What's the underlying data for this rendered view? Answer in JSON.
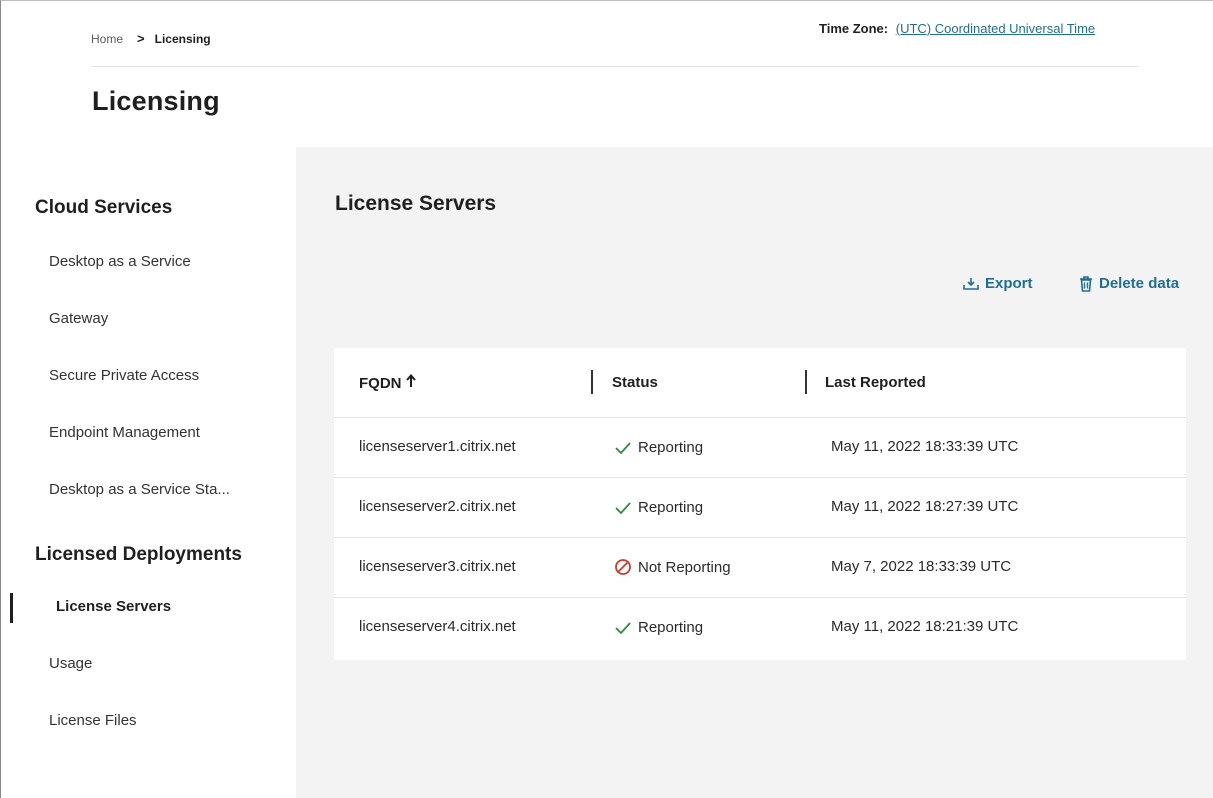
{
  "breadcrumb": {
    "home": "Home",
    "separator": ">",
    "current": "Licensing"
  },
  "timezone": {
    "label": "Time Zone:",
    "value": "(UTC) Coordinated Universal Time"
  },
  "page_title": "Licensing",
  "sidebar": {
    "cloud_heading": "Cloud Services",
    "cloud_items": [
      {
        "label": "Desktop as a Service"
      },
      {
        "label": "Gateway"
      },
      {
        "label": "Secure Private Access"
      },
      {
        "label": "Endpoint Management"
      },
      {
        "label": "Desktop as a Service Sta..."
      }
    ],
    "deploy_heading": "Licensed Deployments",
    "deploy_items": [
      {
        "label": "License Servers",
        "active": true
      },
      {
        "label": "Usage"
      },
      {
        "label": "License Files"
      }
    ]
  },
  "main": {
    "title": "License Servers",
    "actions": {
      "export": "Export",
      "delete": "Delete data"
    },
    "table": {
      "headers": {
        "fqdn": "FQDN",
        "status": "Status",
        "last_reported": "Last Reported"
      },
      "sort_icon": "arrow-up-icon",
      "rows": [
        {
          "fqdn": "licenseserver1.citrix.net",
          "status": "Reporting",
          "status_icon": "check-icon",
          "last_reported": "May 11, 2022 18:33:39 UTC"
        },
        {
          "fqdn": "licenseserver2.citrix.net",
          "status": "Reporting",
          "status_icon": "check-icon",
          "last_reported": "May 11, 2022 18:27:39 UTC"
        },
        {
          "fqdn": "licenseserver3.citrix.net",
          "status": "Not Reporting",
          "status_icon": "prohibited-icon",
          "last_reported": "May 7, 2022 18:33:39 UTC"
        },
        {
          "fqdn": "licenseserver4.citrix.net",
          "status": "Reporting",
          "status_icon": "check-icon",
          "last_reported": "May 11, 2022 18:21:39 UTC"
        }
      ]
    }
  },
  "colors": {
    "link": "#1f6f94",
    "check": "#2e8b3d",
    "error": "#d23a2a",
    "main_bg": "#f3f3f3"
  }
}
